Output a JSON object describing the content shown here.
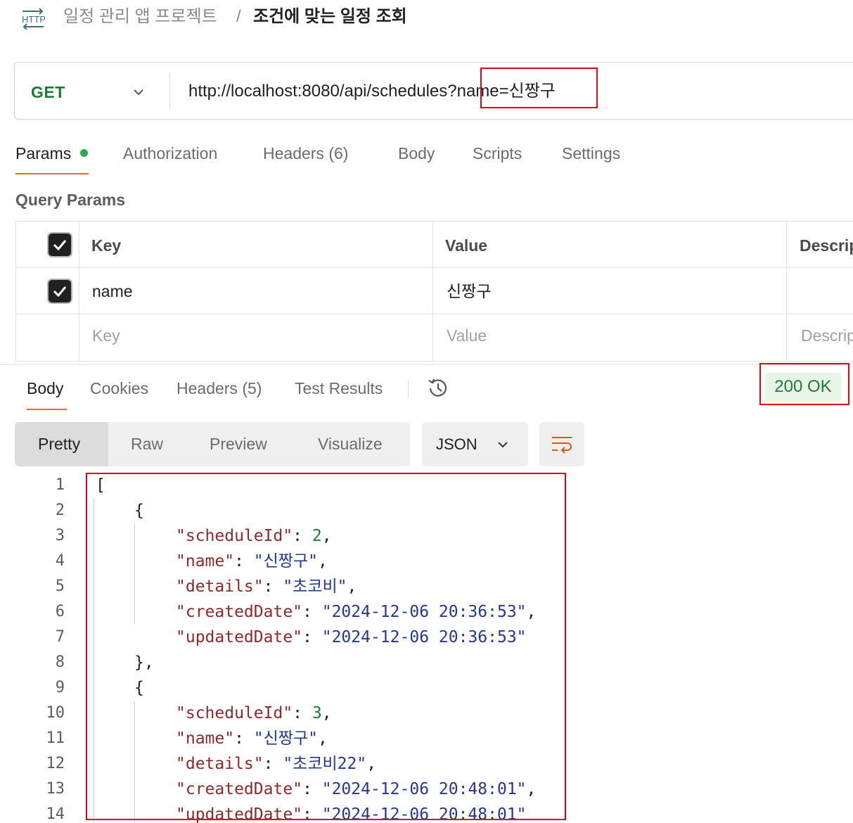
{
  "breadcrumb": {
    "icon_label": "HTTP",
    "parent": "일정 관리 앱 프로젝트",
    "separator": "/",
    "current": "조건에 맞는 일정 조회"
  },
  "request": {
    "method": "GET",
    "url": "http://localhost:8080/api/schedules?name=신짱구"
  },
  "request_tabs": {
    "params": "Params",
    "authorization": "Authorization",
    "headers": "Headers (6)",
    "body": "Body",
    "scripts": "Scripts",
    "settings": "Settings"
  },
  "query_params": {
    "title": "Query Params",
    "headers": {
      "key": "Key",
      "value": "Value",
      "description": "Descrip"
    },
    "rows": [
      {
        "key": "name",
        "value": "신짱구",
        "checked": true
      }
    ],
    "placeholders": {
      "key": "Key",
      "value": "Value",
      "description": "Descrip"
    }
  },
  "response_tabs": {
    "body": "Body",
    "cookies": "Cookies",
    "headers": "Headers (5)",
    "test_results": "Test Results"
  },
  "status": "200 OK",
  "format": {
    "pretty": "Pretty",
    "raw": "Raw",
    "preview": "Preview",
    "visualize": "Visualize",
    "language": "JSON"
  },
  "code": {
    "line_numbers": [
      "1",
      "2",
      "3",
      "4",
      "5",
      "6",
      "7",
      "8",
      "9",
      "10",
      "11",
      "12",
      "13",
      "14"
    ],
    "lines": {
      "l1": "[",
      "l2": "{",
      "l3": {
        "key": "\"scheduleId\"",
        "sep": ": ",
        "value": "2",
        "end": ","
      },
      "l4": {
        "key": "\"name\"",
        "sep": ": ",
        "value": "\"신짱구\"",
        "end": ","
      },
      "l5": {
        "key": "\"details\"",
        "sep": ": ",
        "value": "\"초코비\"",
        "end": ","
      },
      "l6": {
        "key": "\"createdDate\"",
        "sep": ": ",
        "value": "\"2024-12-06 20:36:53\"",
        "end": ","
      },
      "l7": {
        "key": "\"updatedDate\"",
        "sep": ": ",
        "value": "\"2024-12-06 20:36:53\"",
        "end": ""
      },
      "l8": "},",
      "l9": "{",
      "l10": {
        "key": "\"scheduleId\"",
        "sep": ": ",
        "value": "3",
        "end": ","
      },
      "l11": {
        "key": "\"name\"",
        "sep": ": ",
        "value": "\"신짱구\"",
        "end": ","
      },
      "l12": {
        "key": "\"details\"",
        "sep": ": ",
        "value": "\"초코비22\"",
        "end": ","
      },
      "l13": {
        "key": "\"createdDate\"",
        "sep": ": ",
        "value": "\"2024-12-06 20:48:01\"",
        "end": ","
      },
      "l14": {
        "key": "\"updatedDate\"",
        "sep": ": ",
        "value": "\"2024-12-06 20:48:01\"",
        "end": ""
      }
    }
  },
  "colors": {
    "accent": "#e86a2c",
    "method": "#1e7a36",
    "status_bg": "#e7f5e9",
    "highlight": "#e0001a"
  }
}
